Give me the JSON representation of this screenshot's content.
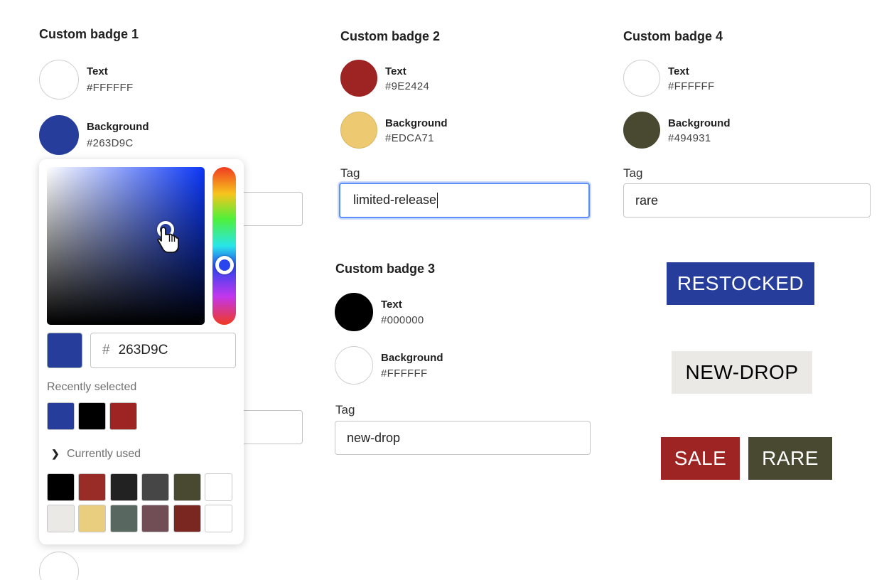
{
  "badge1": {
    "heading": "Custom badge 1",
    "text_label": "Text",
    "text_value": "#FFFFFF",
    "bg_label": "Background",
    "bg_value": "#263D9C"
  },
  "badge2": {
    "heading": "Custom badge 2",
    "text_label": "Text",
    "text_value": "#9E2424",
    "bg_label": "Background",
    "bg_value": "#EDCA71",
    "tag_label": "Tag",
    "tag_value": "limited-release"
  },
  "badge3": {
    "heading": "Custom badge 3",
    "text_label": "Text",
    "text_value": "#000000",
    "bg_label": "Background",
    "bg_value": "#FFFFFF",
    "tag_label": "Tag",
    "tag_value": "new-drop"
  },
  "badge4": {
    "heading": "Custom badge 4",
    "text_label": "Text",
    "text_value": "#FFFFFF",
    "bg_label": "Background",
    "bg_value": "#494931",
    "tag_label": "Tag",
    "tag_value": "rare"
  },
  "picker": {
    "hex_prefix": "#",
    "hex_value": "263D9C",
    "recent_label": "Recently selected",
    "recent_colors": [
      "#263D9C",
      "#000000",
      "#9E2424"
    ],
    "current_label": "Currently used",
    "current_colors": [
      "#000000",
      "#992C27",
      "#222222",
      "#464646",
      "#494931",
      "#FFFFFF",
      "#EAE9E5",
      "#E8CE7E",
      "#586860",
      "#714E56",
      "#7A2621",
      "#FFFFFF"
    ]
  },
  "previews": {
    "restocked": "RESTOCKED",
    "new_drop": "NEW-DROP",
    "sale": "SALE",
    "rare": "RARE"
  },
  "colors": {
    "accent_blue": "#263D9C",
    "focus_ring": "#5E8EF7",
    "sale_bg": "#9E2424",
    "rare_bg": "#494931",
    "new_drop_bg": "#EAE9E5"
  }
}
